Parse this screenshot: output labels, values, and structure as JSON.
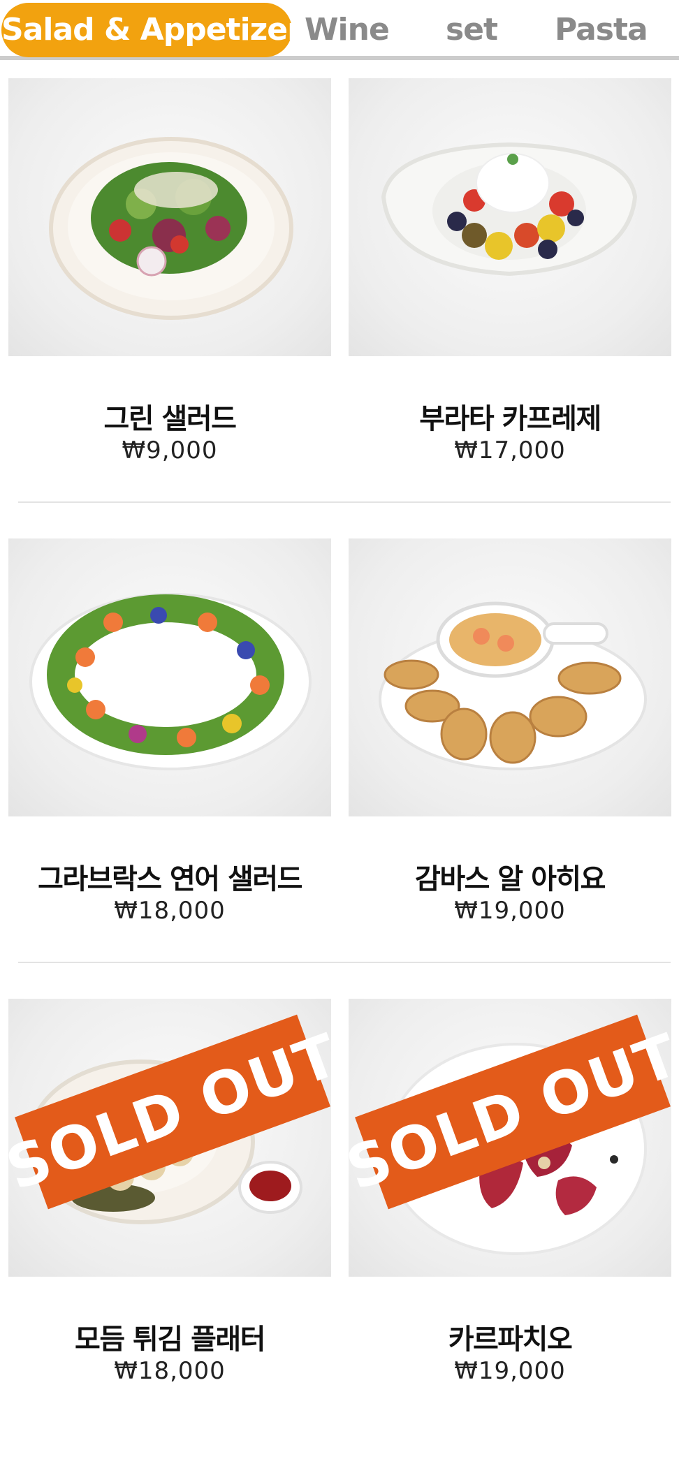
{
  "tabs": [
    {
      "label": "Salad & Appetizer",
      "active": true
    },
    {
      "label": "Wine",
      "active": false
    },
    {
      "label": "set",
      "active": false
    },
    {
      "label": "Pasta",
      "active": false
    }
  ],
  "colors": {
    "accent": "#f2a20f",
    "sold_out": "#e35b1a",
    "tab_inactive": "#8a8a8a"
  },
  "sold_out_label": "SOLD OUT",
  "menu": [
    {
      "name": "그린 샐러드",
      "price": "₩9,000",
      "sold_out": false
    },
    {
      "name": "부라타 카프레제",
      "price": "₩17,000",
      "sold_out": false
    },
    {
      "name": "그라브락스 연어 샐러드",
      "price": "₩18,000",
      "sold_out": false
    },
    {
      "name": "감바스 알 아히요",
      "price": "₩19,000",
      "sold_out": false
    },
    {
      "name": "모듬 튀김 플래터",
      "price": "₩18,000",
      "sold_out": true
    },
    {
      "name": "카르파치오",
      "price": "₩19,000",
      "sold_out": true
    }
  ]
}
